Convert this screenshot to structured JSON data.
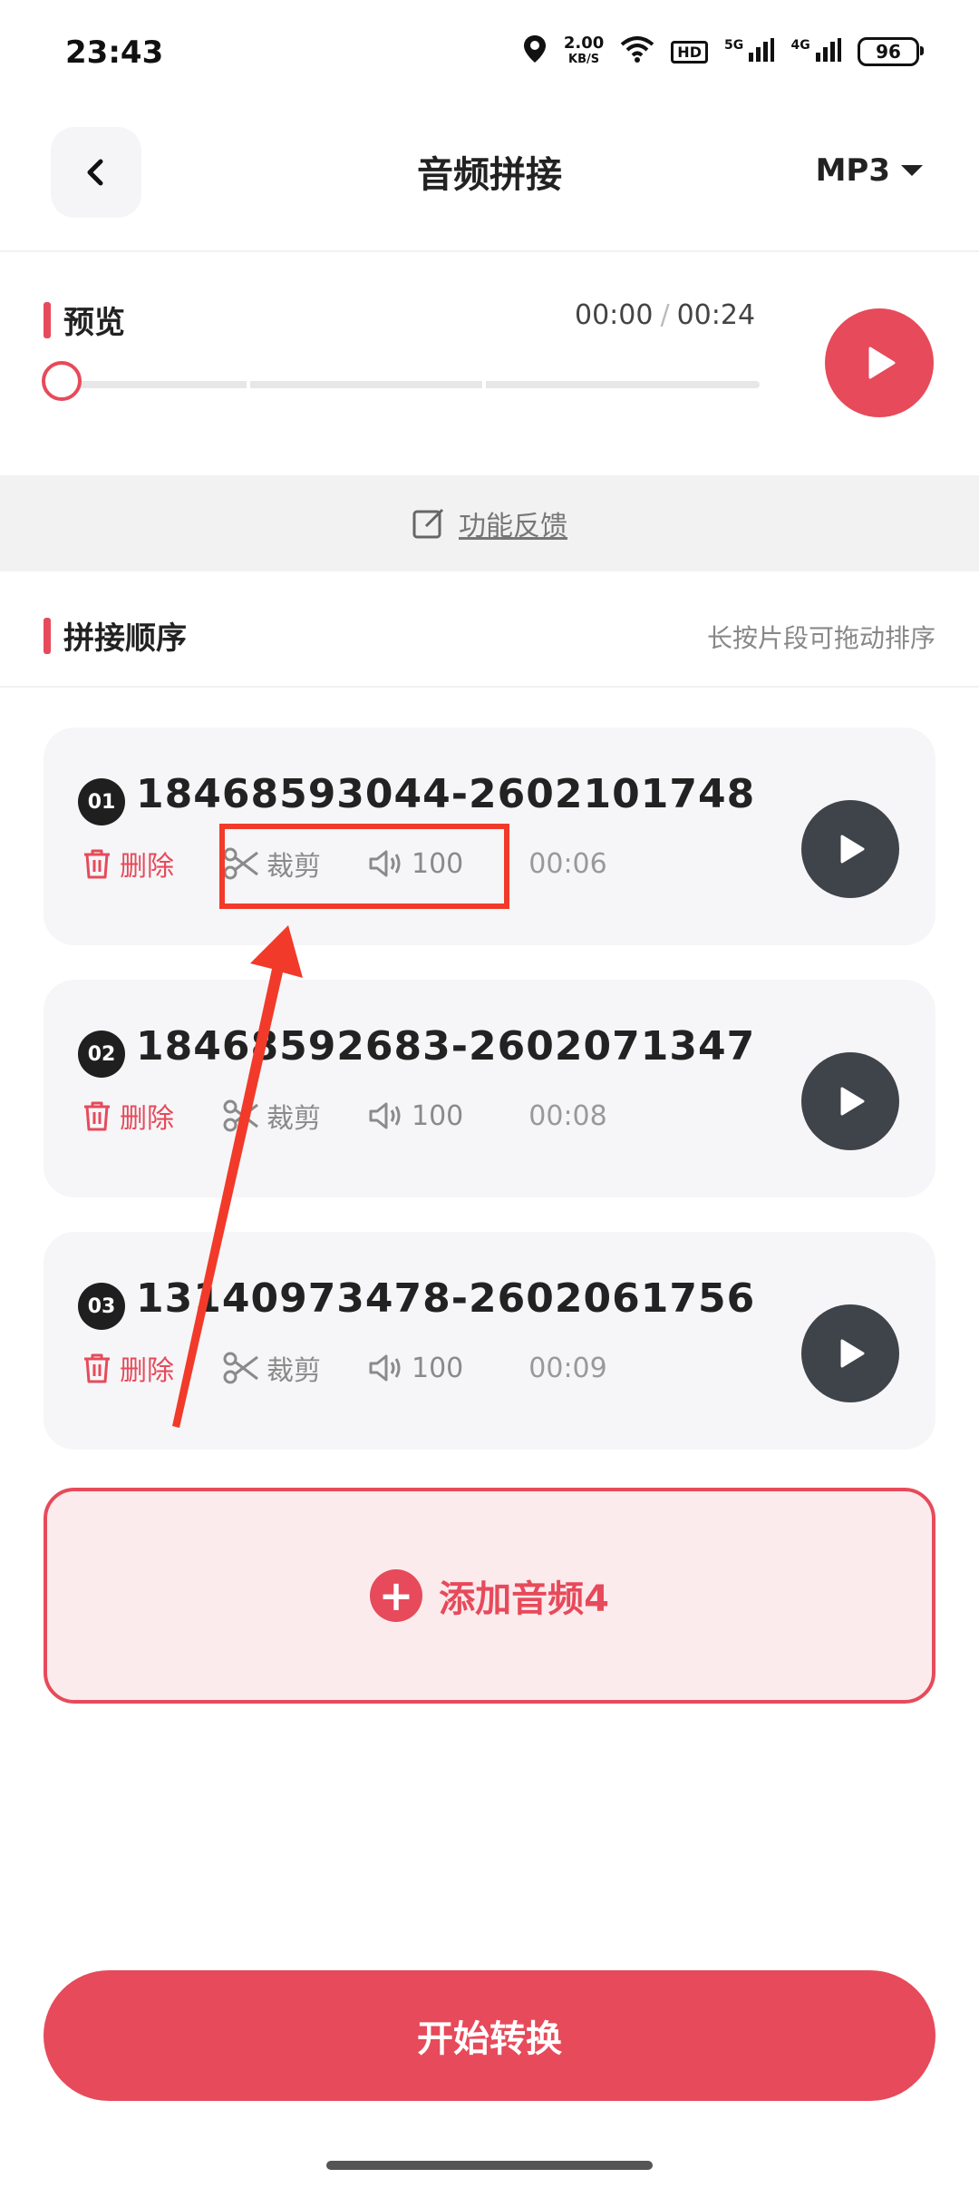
{
  "status_bar": {
    "time": "23:43",
    "net_speed_value": "2.00",
    "net_speed_unit": "KB/S",
    "hd_badge": "HD",
    "signal1_label": "5G",
    "signal2_label": "4G",
    "battery": "96"
  },
  "header": {
    "title": "音频拼接",
    "format": "MP3"
  },
  "preview": {
    "label": "预览",
    "current_time": "00:00",
    "separator": "/",
    "total_time": "00:24",
    "progress": 0
  },
  "feedback": {
    "label": "功能反馈"
  },
  "order": {
    "label": "拼接顺序",
    "hint": "长按片段可拖动排序"
  },
  "clips": [
    {
      "index": "01",
      "name": "18468593044-2602101748",
      "delete_label": "删除",
      "trim_label": "裁剪",
      "volume": "100",
      "duration": "00:06"
    },
    {
      "index": "02",
      "name": "18468592683-2602071347",
      "delete_label": "删除",
      "trim_label": "裁剪",
      "volume": "100",
      "duration": "00:08"
    },
    {
      "index": "03",
      "name": "13140973478-2602061756",
      "delete_label": "删除",
      "trim_label": "裁剪",
      "volume": "100",
      "duration": "00:09"
    }
  ],
  "add_audio": {
    "label": "添加音频4"
  },
  "start_button": {
    "label": "开始转换"
  },
  "colors": {
    "accent": "#e74a5a",
    "annotation": "#f23a2a",
    "dark_play": "#3f434a"
  }
}
